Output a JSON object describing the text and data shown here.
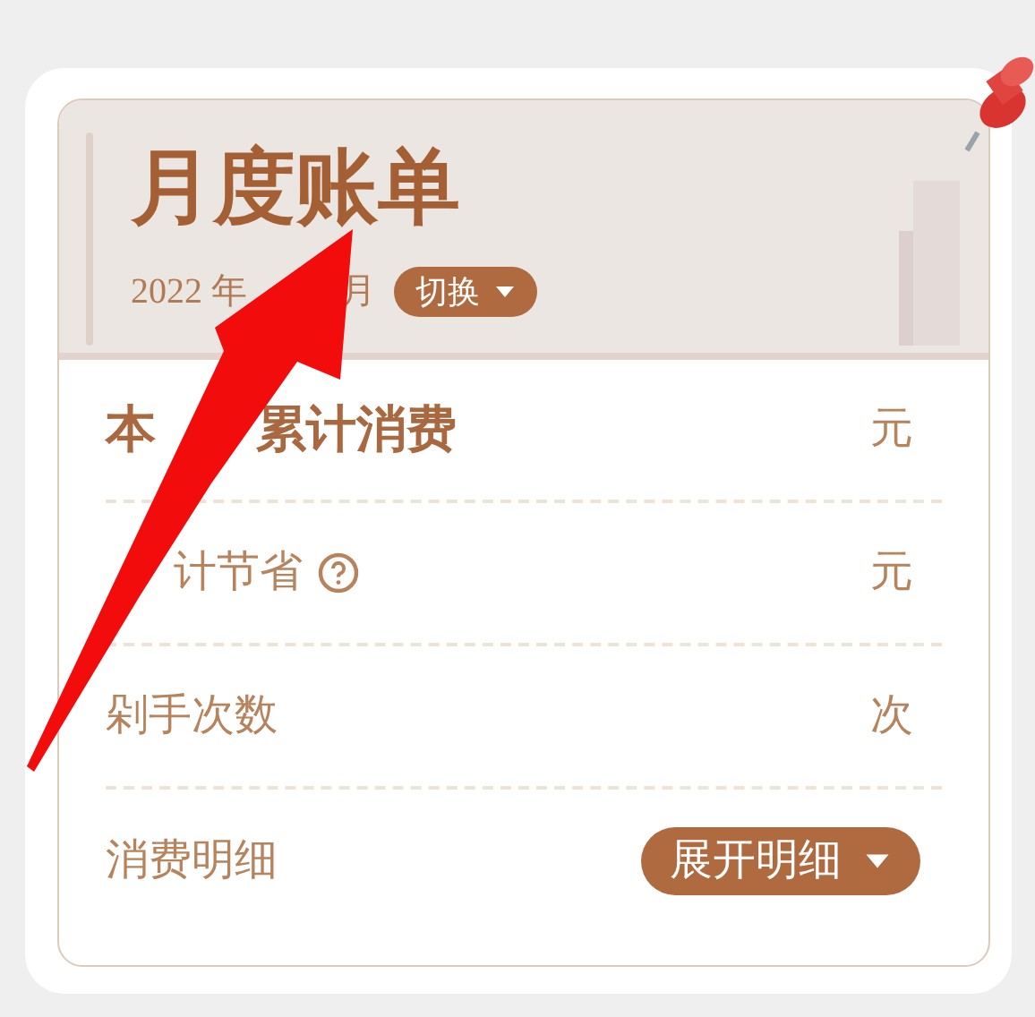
{
  "header": {
    "title": "月度账单",
    "year": "2022 年",
    "month_suffix": "月",
    "switch_label": "切换"
  },
  "rows": [
    {
      "kind": "total",
      "label_start": "本",
      "label_end": "累计消费",
      "unit": "元"
    },
    {
      "kind": "help",
      "label_end": "计节省",
      "unit": "元"
    },
    {
      "kind": "plain",
      "label": "剁手次数",
      "unit": "次"
    },
    {
      "kind": "action",
      "label": "消费明细",
      "button": "展开明细"
    }
  ]
}
